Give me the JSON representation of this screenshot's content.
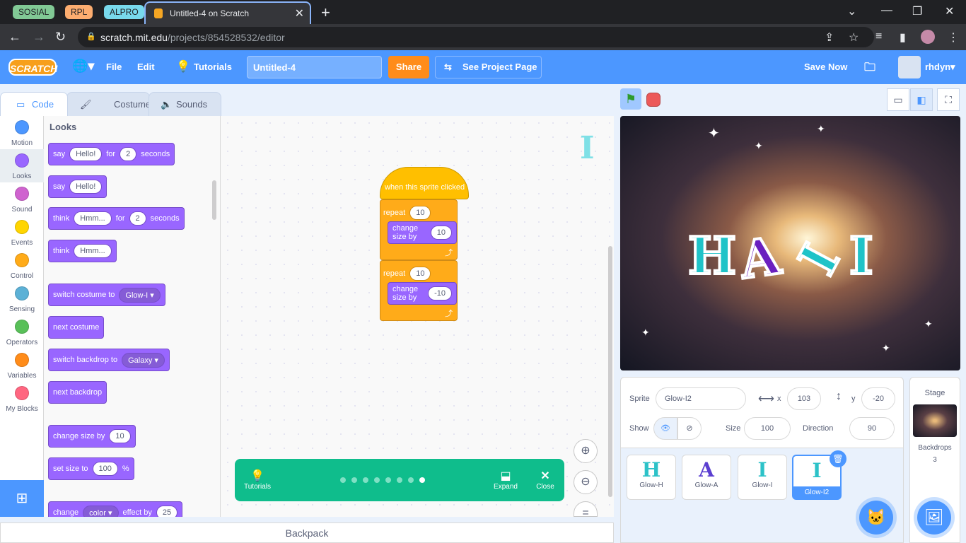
{
  "browser": {
    "groups": [
      {
        "label": "SOSIAL",
        "color": "#81c995"
      },
      {
        "label": "RPL",
        "color": "#fcad70"
      },
      {
        "label": "ALPRO",
        "color": "#78d9ec"
      }
    ],
    "tab_title": "Untitled-4 on Scratch",
    "url_host": "scratch.mit.edu",
    "url_path": "/projects/854528532/editor"
  },
  "menubar": {
    "logo": "SCRATCH",
    "file": "File",
    "edit": "Edit",
    "tutorials": "Tutorials",
    "project_title": "Untitled-4",
    "share": "Share",
    "see_project_page": "See Project Page",
    "save_now": "Save Now",
    "username": "rhdyn"
  },
  "editor_tabs": {
    "code": "Code",
    "costumes": "Costumes",
    "sounds": "Sounds"
  },
  "categories": [
    {
      "label": "Motion",
      "color": "#4c97ff"
    },
    {
      "label": "Looks",
      "color": "#9966ff"
    },
    {
      "label": "Sound",
      "color": "#cf63cf"
    },
    {
      "label": "Events",
      "color": "#ffd500"
    },
    {
      "label": "Control",
      "color": "#ffab19"
    },
    {
      "label": "Sensing",
      "color": "#5cb1d6"
    },
    {
      "label": "Operators",
      "color": "#59c059"
    },
    {
      "label": "Variables",
      "color": "#ff8c1a"
    },
    {
      "label": "My Blocks",
      "color": "#ff6680"
    }
  ],
  "palette": {
    "title": "Looks",
    "b1": {
      "w1": "say",
      "i1": "Hello!",
      "w2": "for",
      "i2": "2",
      "w3": "seconds"
    },
    "b2": {
      "w1": "say",
      "i1": "Hello!"
    },
    "b3": {
      "w1": "think",
      "i1": "Hmm...",
      "w2": "for",
      "i2": "2",
      "w3": "seconds"
    },
    "b4": {
      "w1": "think",
      "i1": "Hmm..."
    },
    "b5": {
      "w1": "switch costume to",
      "d1": "Glow-I ▾"
    },
    "b6": {
      "w1": "next costume"
    },
    "b7": {
      "w1": "switch backdrop to",
      "d1": "Galaxy ▾"
    },
    "b8": {
      "w1": "next backdrop"
    },
    "b9": {
      "w1": "change size by",
      "i1": "10"
    },
    "b10": {
      "w1": "set size to",
      "i1": "100",
      "w2": "%"
    },
    "b11": {
      "w1": "change",
      "d1": "color ▾",
      "w2": "effect by",
      "i1": "25"
    }
  },
  "script": {
    "hat": "when this sprite clicked",
    "repeat1": {
      "label": "repeat",
      "count": "10",
      "inner_label": "change size by",
      "inner_value": "10"
    },
    "repeat2": {
      "label": "repeat",
      "count": "10",
      "inner_label": "change size by",
      "inner_value": "-10"
    }
  },
  "tutorial_bar": {
    "tutorials": "Tutorials",
    "expand": "Expand",
    "close": "Close",
    "steps": 8,
    "current_step": 8
  },
  "backpack": "Backpack",
  "stage": {
    "letters": [
      "H",
      "A",
      "I",
      "I"
    ]
  },
  "sprite_info": {
    "sprite_label": "Sprite",
    "sprite_name": "Glow-I2",
    "x_label": "x",
    "x": "103",
    "y_label": "y",
    "y": "-20",
    "show_label": "Show",
    "size_label": "Size",
    "size": "100",
    "direction_label": "Direction",
    "direction": "90"
  },
  "sprites": [
    {
      "glyph": "H",
      "name": "Glow-H"
    },
    {
      "glyph": "A",
      "name": "Glow-A"
    },
    {
      "glyph": "I",
      "name": "Glow-I"
    },
    {
      "glyph": "I",
      "name": "Glow-I2"
    }
  ],
  "stage_panel": {
    "title": "Stage",
    "backdrops_label": "Backdrops",
    "backdrops_count": "3"
  }
}
